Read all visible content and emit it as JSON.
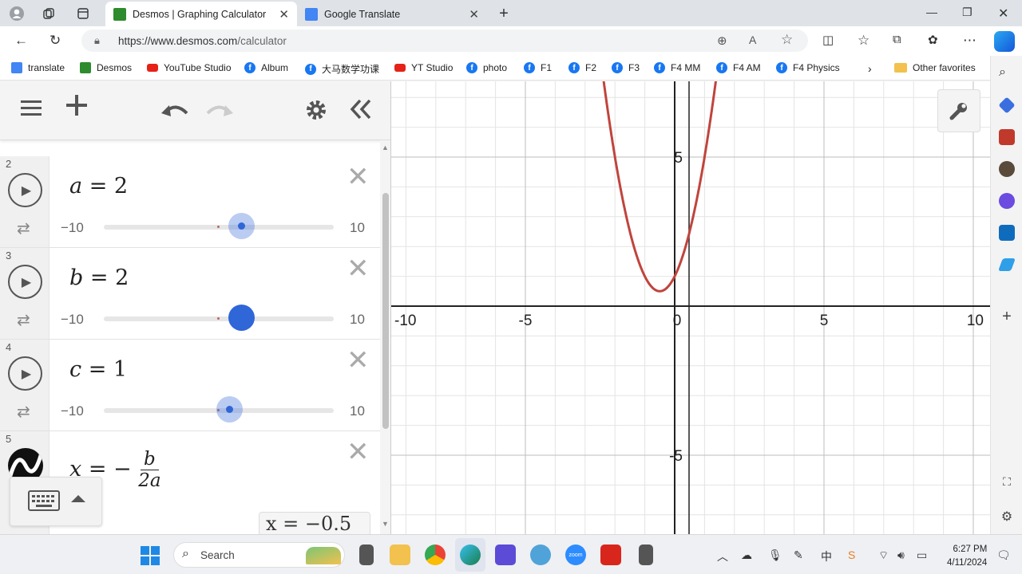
{
  "browser": {
    "tabs": [
      {
        "title": "Desmos | Graphing Calculator",
        "active": true
      },
      {
        "title": "Google Translate",
        "active": false
      }
    ],
    "url_prefix": "https://www.desmos.com",
    "url_path": "/calculator",
    "favorites": [
      "translate",
      "Desmos",
      "YouTube Studio",
      "Album",
      "大马数学功课",
      "YT Studio",
      "photo",
      "F1",
      "F2",
      "F3",
      "F4 MM",
      "F4 AM",
      "F4 Physics"
    ],
    "other_favorites": "Other favorites"
  },
  "expressions": [
    {
      "index": "2",
      "var": "a",
      "value": "2",
      "min": "−10",
      "max": "10",
      "slider_fraction": 0.6
    },
    {
      "index": "3",
      "var": "b",
      "value": "2",
      "min": "−10",
      "max": "10",
      "slider_fraction": 0.6
    },
    {
      "index": "4",
      "var": "c",
      "value": "1",
      "min": "−10",
      "max": "10",
      "slider_fraction": 0.55
    }
  ],
  "expr5": {
    "index": "5",
    "lhs": "x",
    "numerator": "b",
    "denominator": "2a",
    "result": "x = −0.5"
  },
  "graph": {
    "x_ticks": [
      "-10",
      "-5",
      "0",
      "5",
      "10"
    ],
    "y_ticks": [
      "5",
      "-5"
    ],
    "curve_color": "#c0443d",
    "function": "y = 2x^2 + 2x + 1"
  },
  "taskbar": {
    "search_label": "Search",
    "time": "6:27 PM",
    "date": "4/11/2024"
  }
}
